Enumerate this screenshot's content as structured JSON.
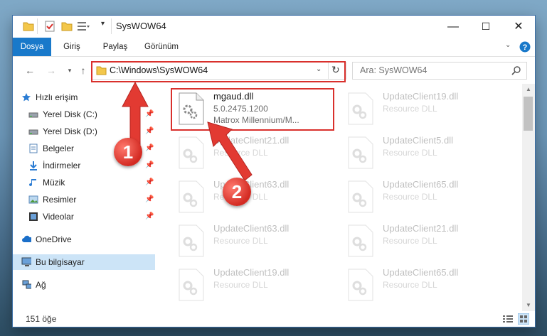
{
  "window": {
    "title": "SysWOW64",
    "controls": {
      "minimize": "—",
      "maximize": "☐",
      "close": "✕"
    }
  },
  "ribbon": {
    "tabs": [
      {
        "label": "Dosya",
        "active": true
      },
      {
        "label": "Giriş"
      },
      {
        "label": "Paylaş"
      },
      {
        "label": "Görünüm"
      }
    ]
  },
  "nav": {
    "address": "C:\\Windows\\SysWOW64",
    "search_placeholder": "Ara: SysWOW64"
  },
  "sidebar": {
    "items": [
      {
        "label": "Hızlı erişim",
        "icon": "star-icon",
        "pinned": false
      },
      {
        "label": "Yerel Disk (C:)",
        "icon": "drive-icon",
        "pinned": true
      },
      {
        "label": "Yerel Disk (D:)",
        "icon": "drive-icon",
        "pinned": true
      },
      {
        "label": "Belgeler",
        "icon": "documents-icon",
        "pinned": true
      },
      {
        "label": "İndirmeler",
        "icon": "download-icon",
        "pinned": true
      },
      {
        "label": "Müzik",
        "icon": "music-icon",
        "pinned": true
      },
      {
        "label": "Resimler",
        "icon": "pictures-icon",
        "pinned": true
      },
      {
        "label": "Videolar",
        "icon": "video-icon",
        "pinned": true
      },
      {
        "label": "OneDrive",
        "icon": "cloud-icon",
        "pinned": false
      },
      {
        "label": "Bu bilgisayar",
        "icon": "computer-icon",
        "pinned": false,
        "selected": true
      },
      {
        "label": "Ağ",
        "icon": "network-icon",
        "pinned": false
      }
    ]
  },
  "files": [
    {
      "name": "mgaud.dll",
      "line2": "5.0.2475.1200",
      "line3": "Matrox Millennium/M...",
      "highlighted": true
    },
    {
      "name": "UpdateClient19.dll",
      "line2": "Resource DLL"
    },
    {
      "name": "UpdateClient21.dll",
      "line2": "Resource DLL"
    },
    {
      "name": "UpdateClient5.dll",
      "line2": "Resource DLL"
    },
    {
      "name": "UpdateClient63.dll",
      "line2": "Resource DLL"
    },
    {
      "name": "UpdateClient65.dll",
      "line2": "Resource DLL"
    },
    {
      "name": "UpdateClient63.dll",
      "line2": "Resource DLL"
    },
    {
      "name": "UpdateClient21.dll",
      "line2": "Resource DLL"
    },
    {
      "name": "UpdateClient19.dll",
      "line2": "Resource DLL"
    },
    {
      "name": "UpdateClient65.dll",
      "line2": "Resource DLL"
    }
  ],
  "status": {
    "item_count": "151 öğe"
  },
  "annotations": {
    "step1": "1",
    "step2": "2"
  },
  "colors": {
    "accent": "#1979ca",
    "annotation_red": "#d9302c",
    "selection": "#cce4f7"
  }
}
